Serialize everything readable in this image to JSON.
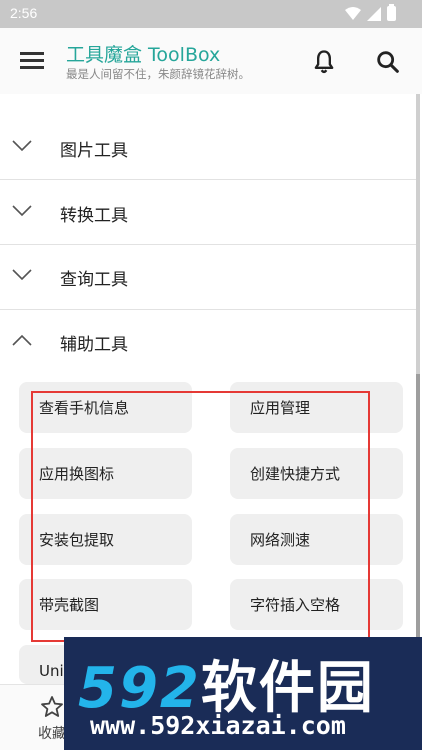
{
  "status_bar": {
    "time": "2:56"
  },
  "app_bar": {
    "title": "工具魔盒 ToolBox",
    "subtitle": "最是人间留不住，朱颜辞镜花辞树。",
    "icons": {
      "menu": "menu-icon",
      "bell": "bell-icon",
      "search": "search-icon"
    }
  },
  "categories": [
    {
      "label": "图片工具",
      "expanded": false
    },
    {
      "label": "转换工具",
      "expanded": false
    },
    {
      "label": "查询工具",
      "expanded": false
    },
    {
      "label": "辅助工具",
      "expanded": true
    }
  ],
  "tools": [
    {
      "label": "查看手机信息"
    },
    {
      "label": "应用管理"
    },
    {
      "label": "应用换图标"
    },
    {
      "label": "创建快捷方式"
    },
    {
      "label": "安装包提取"
    },
    {
      "label": "网络测速"
    },
    {
      "label": "带壳截图"
    },
    {
      "label": "字符插入空格"
    },
    {
      "label": "Uni"
    }
  ],
  "bottom_nav": {
    "favorites_label": "收藏"
  },
  "watermark": {
    "logo_number": "592",
    "logo_text": "软件园",
    "url": "www.592xiazai.com"
  },
  "colors": {
    "accent": "#26a69a",
    "highlight_box": "#e53935",
    "tool_bg": "#efefef",
    "watermark_bg": "#1a2c57",
    "watermark_blue": "#23b4ea"
  }
}
